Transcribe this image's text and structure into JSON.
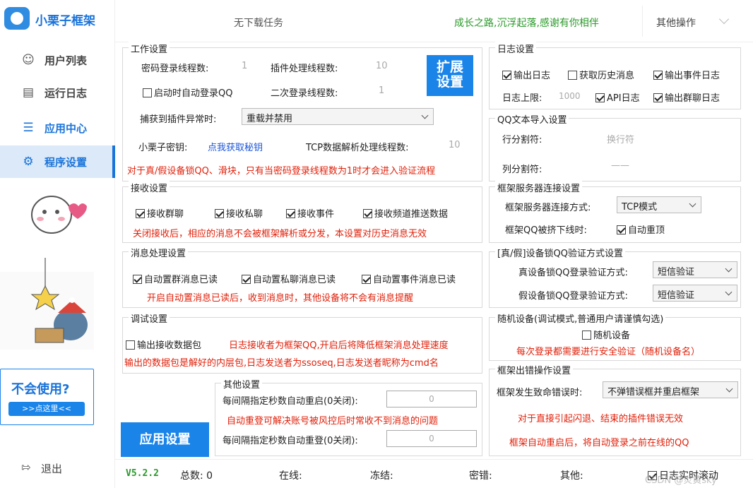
{
  "app": {
    "title": "小栗子框架"
  },
  "sidebar": {
    "items": [
      {
        "label": "用户列表"
      },
      {
        "label": "运行日志"
      },
      {
        "label": "应用中心"
      },
      {
        "label": "程序设置"
      }
    ],
    "help_title": "不会使用?",
    "help_link": ">>点这里<<",
    "logout": "退出"
  },
  "topbar": {
    "download_status": "无下载任务",
    "slogan": "成长之路,沉浮起落,感谢有你相伴",
    "more_ops": "其他操作"
  },
  "work": {
    "title": "工作设置",
    "pwd_threads_label": "密码登录线程数:",
    "pwd_threads_value": "1",
    "plugin_threads_label": "插件处理线程数:",
    "plugin_threads_value": "10",
    "ext_btn_1": "扩展",
    "ext_btn_2": "设置",
    "auto_login": "启动时自动登录QQ",
    "second_login_label": "二次登录线程数:",
    "second_login_value": "1",
    "exception_label": "捕获到插件异常时:",
    "exception_value": "重载并禁用",
    "key_label": "小栗子密钥:",
    "key_link": "点我获取秘钥",
    "tcp_label": "TCP数据解析处理线程数:",
    "tcp_value": "10",
    "notice": "对于真/假设备锁QQ、滑块，只有当密码登录线程数为1时才会进入验证流程"
  },
  "receive": {
    "title": "接收设置",
    "group": "接收群聊",
    "private": "接收私聊",
    "event": "接收事件",
    "channel": "接收频道推送数据",
    "notice": "关闭接收后，相应的消息不会被框架解析或分发，本设置对历史消息无效"
  },
  "msg": {
    "title": "消息处理设置",
    "group_read": "自动置群消息已读",
    "private_read": "自动置私聊消息已读",
    "event_read": "自动置事件消息已读",
    "notice": "开启自动置消息已读后，收到消息时，其他设备将不会有消息提醒"
  },
  "debug": {
    "title": "调试设置",
    "output_packet": "输出接收数据包",
    "notice1": "日志接收者为框架QQ,开启后将降低框架消息处理速度",
    "notice2": "输出的数据包是解好的内层包,日志发送者为ssoseq,日志发送者昵称为cmd名"
  },
  "other": {
    "title": "其他设置",
    "restart_label": "每间隔指定秒数自动重启(0关闭):",
    "restart_value": "0",
    "notice": "自动重登可解决账号被风控后时常收不到消息的问题",
    "relogin_label": "每间隔指定秒数自动重登(0关闭):",
    "relogin_value": "0"
  },
  "apply_btn": "应用设置",
  "log": {
    "title": "日志设置",
    "output": "输出日志",
    "history": "获取历史消息",
    "event_log": "输出事件日志",
    "limit_label": "日志上限:",
    "limit_value": "1000",
    "api_log": "API日志",
    "group_log": "输出群聊日志"
  },
  "qqtext": {
    "title": "QQ文本导入设置",
    "row_label": "行分割符:",
    "row_value": "换行符",
    "col_label": "列分割符:",
    "col_value": "——"
  },
  "server": {
    "title": "框架服务器连接设置",
    "mode_label": "框架服务器连接方式:",
    "mode_value": "TCP模式",
    "kick_label": "框架QQ被挤下线时:",
    "kick_opt": "自动重顶"
  },
  "lock": {
    "title": "[真/假]设备锁QQ验证方式设置",
    "real_label": "真设备锁QQ登录验证方式:",
    "real_value": "短信验证",
    "fake_label": "假设备锁QQ登录验证方式:",
    "fake_value": "短信验证"
  },
  "random": {
    "title": "随机设备(调试模式,普通用户请谨慎勾选)",
    "opt": "随机设备",
    "notice": "每次登录都需要进行安全验证（随机设备名）"
  },
  "error": {
    "title": "框架出错操作设置",
    "label": "框架发生致命错误时:",
    "value": "不弹错误框并重启框架",
    "notice1": "对于直接引起闪退、结束的插件错误无效",
    "notice2": "框架自动重启后，将自动登录之前在线的QQ"
  },
  "status": {
    "version": "V5.2.2",
    "total": "总数: 0",
    "online": "在线:",
    "frozen": "冻结:",
    "pwd_err": "密错:",
    "other": "其他:",
    "scroll": "日志实时滚动",
    "watermark": "CSDN @炎黄sky"
  },
  "colors": {
    "accent": "#1a84e8",
    "warn": "#e0200a",
    "slogan": "#2a9a2a"
  }
}
